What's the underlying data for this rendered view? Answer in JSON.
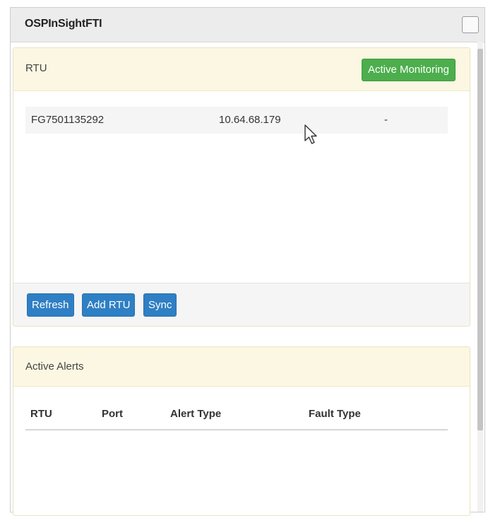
{
  "window": {
    "title": "OSPInSightFTI"
  },
  "rtu_panel": {
    "heading": "RTU",
    "status_button": "Active Monitoring",
    "rows": [
      {
        "id": "FG7501135292",
        "ip": "10.64.68.179",
        "extra": "-"
      }
    ],
    "buttons": {
      "refresh": "Refresh",
      "add": "Add RTU",
      "sync": "Sync"
    }
  },
  "alerts_panel": {
    "heading": "Active Alerts",
    "columns": [
      "RTU",
      "Port",
      "Alert Type",
      "Fault Type"
    ]
  },
  "colors": {
    "success": "#4cae4c",
    "primary": "#2f7fc4",
    "panel_heading": "#fbf7e2"
  }
}
